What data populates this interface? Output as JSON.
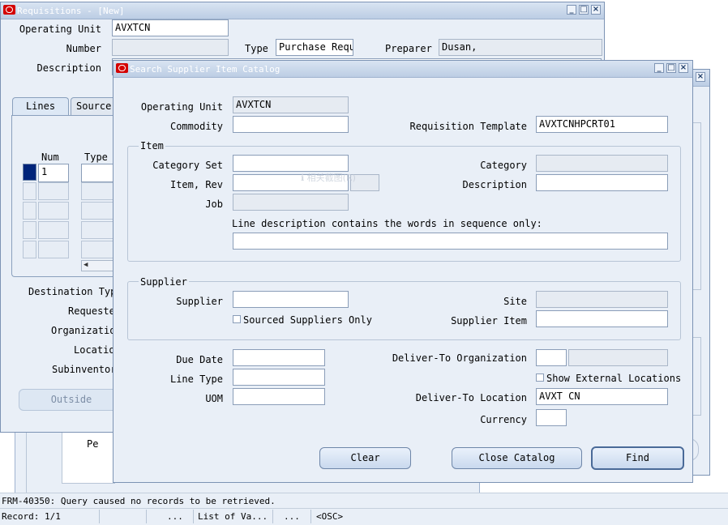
{
  "requisitions": {
    "title": "Requisitions - [New]",
    "operating_unit_label": "Operating Unit",
    "operating_unit_value": "AVXTCN",
    "number_label": "Number",
    "type_label": "Type",
    "type_value": "Purchase Requ",
    "preparer_label": "Preparer",
    "preparer_value": "Dusan,",
    "description_label": "Description",
    "tab_lines": "Lines",
    "tab_source": "Source",
    "num_header": "Num",
    "type_header": "Type",
    "first_row_num": "1",
    "destination_type_label": "Destination Typ",
    "requester_label": "Requeste",
    "organization_label": "Organizatio",
    "location_label": "Locatio",
    "subinventory_label": "Subinventor",
    "outside_button": "Outside",
    "pe_label": "Pe"
  },
  "search_catalog": {
    "title": "Search Supplier Item Catalog",
    "operating_unit_label": "Operating Unit",
    "operating_unit_value": "AVXTCN",
    "commodity_label": "Commodity",
    "commodity_value": "",
    "requisition_template_label": "Requisition Template",
    "requisition_template_value": "AVXTCNHPCRT01",
    "item_group_label": "Item",
    "category_set_label": "Category Set",
    "category_label": "Category",
    "item_rev_label": "Item, Rev",
    "description_label": "Description",
    "job_label": "Job",
    "line_desc_label": "Line description contains the words in sequence only:",
    "ghost_text": "ℹ 相关截图(R)",
    "supplier_group_label": "Supplier",
    "supplier_label": "Supplier",
    "site_label": "Site",
    "sourced_only_label": "Sourced Suppliers Only",
    "supplier_item_label": "Supplier Item",
    "due_date_label": "Due Date",
    "line_type_label": "Line Type",
    "uom_label": "UOM",
    "deliver_to_org_label": "Deliver-To Organization",
    "show_external_label": "Show External Locations",
    "deliver_to_location_label": "Deliver-To Location",
    "deliver_to_location_value": "AVXT CN",
    "currency_label": "Currency",
    "clear_button": "Clear",
    "close_catalog_button": "Close Catalog",
    "find_button": "Find"
  },
  "status": {
    "message": "FRM-40350: Query caused no records to be retrieved.",
    "record": "Record: 1/1",
    "seg_dots1": "...",
    "list_of_values": "List of Va...",
    "seg_dots2": "...",
    "osc": "<OSC>"
  },
  "colors": {
    "window_bg": "#e9eff7",
    "titlebar": "#bccde4",
    "oracle_red": "#d40000",
    "selected_row": "#00247a"
  }
}
